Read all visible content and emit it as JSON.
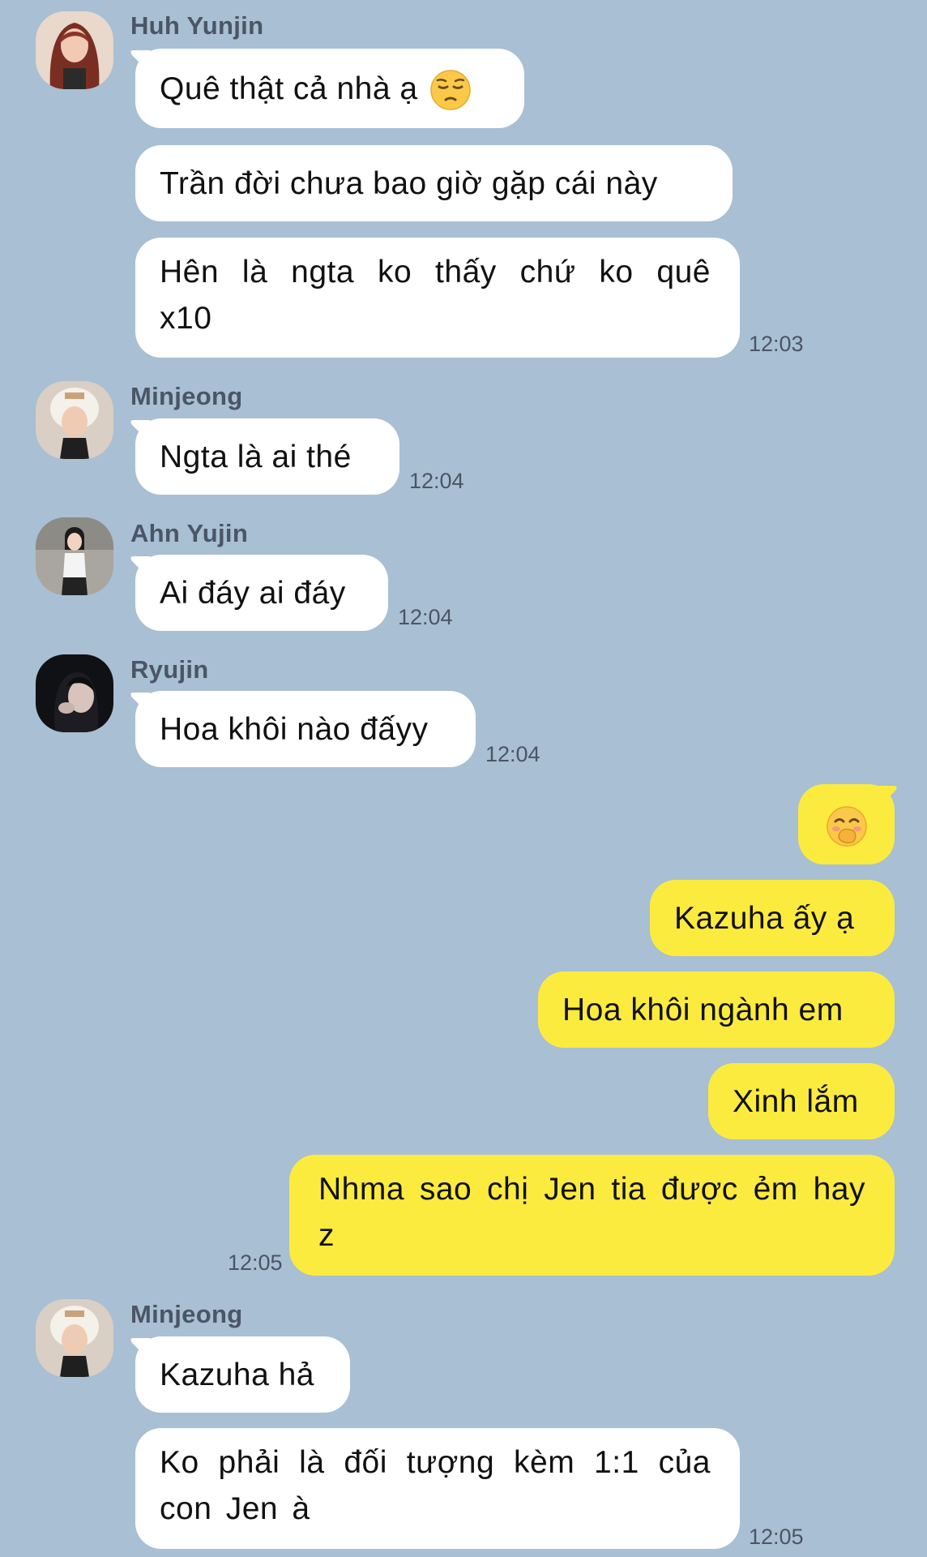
{
  "messages": [
    {
      "sender": "Huh Yunjin",
      "bubbles": [
        "Quê thật cả nhà ạ",
        "Trần đời chưa bao giờ gặp cái này",
        "Hên là ngta ko thấy chứ ko quê x10"
      ],
      "time": "12:03"
    },
    {
      "sender": "Minjeong",
      "bubbles": [
        "Ngta là ai thé"
      ],
      "time": "12:04"
    },
    {
      "sender": "Ahn Yujin",
      "bubbles": [
        "Ai đáy ai đáy"
      ],
      "time": "12:04"
    },
    {
      "sender": "Ryujin",
      "bubbles": [
        "Hoa khôi nào đấyy"
      ],
      "time": "12:04"
    },
    {
      "sender": "me",
      "bubbles": [
        "",
        "Kazuha ấy ạ",
        "Hoa khôi ngành em",
        "Xinh lắm",
        "Nhma sao chị Jen tia được ẻm hay z"
      ],
      "time": "12:05"
    },
    {
      "sender": "Minjeong",
      "bubbles": [
        "Kazuha hả",
        "Ko phải là đối tượng kèm 1:1 của con Jen à"
      ],
      "time": "12:05"
    }
  ],
  "emojis": {
    "pensive": "pensive-face-icon",
    "giggle": "face-with-hand-over-mouth-icon"
  },
  "colors": {
    "background": "#a9bfd3",
    "incoming": "#ffffff",
    "outgoing": "#fceb3f",
    "meta": "#4a5566"
  }
}
